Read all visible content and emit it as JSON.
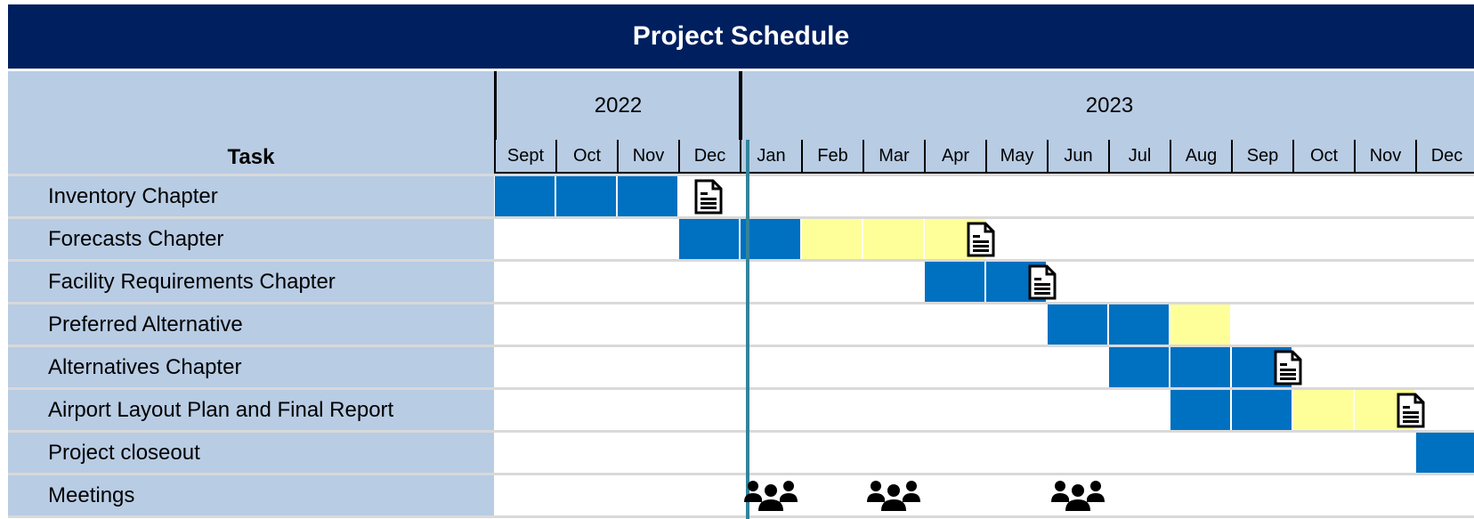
{
  "title": "Project Schedule",
  "header": {
    "task_label": "Task",
    "years": [
      {
        "label": "2022",
        "span": 4
      },
      {
        "label": "2023",
        "span": 12
      }
    ],
    "months": [
      "Sept",
      "Oct",
      "Nov",
      "Dec",
      "Jan",
      "Feb",
      "Mar",
      "Apr",
      "May",
      "Jun",
      "Jul",
      "Aug",
      "Sep",
      "Oct",
      "Nov",
      "Dec"
    ]
  },
  "colors": {
    "title_bg": "#001f5f",
    "header_bg": "#b8cce4",
    "active": "#0070c0",
    "review": "#ffff99",
    "today_line": "#31849b"
  },
  "current_month_marker": "Jan 2023",
  "tasks": [
    {
      "label": "Inventory Chapter",
      "active": [
        0,
        1,
        2
      ],
      "review": [],
      "deliverable": 3
    },
    {
      "label": "Forecasts Chapter",
      "active": [
        3,
        4
      ],
      "review": [
        5,
        6,
        7
      ],
      "deliverable": 7
    },
    {
      "label": "Facility Requirements Chapter",
      "active": [
        7,
        8
      ],
      "review": [],
      "deliverable": 8
    },
    {
      "label": "Preferred Alternative",
      "active": [
        9,
        10
      ],
      "review": [
        11
      ],
      "deliverable": null
    },
    {
      "label": "Alternatives Chapter",
      "active": [
        10,
        11,
        12
      ],
      "review": [],
      "deliverable": 12
    },
    {
      "label": "Airport Layout Plan and Final Report",
      "active": [
        11,
        12
      ],
      "review": [
        13,
        14
      ],
      "deliverable": 14
    },
    {
      "label": "Project closeout",
      "active": [
        15
      ],
      "review": [],
      "deliverable": null
    },
    {
      "label": "Meetings",
      "active": [],
      "review": [],
      "deliverable": null,
      "meetings": [
        4,
        6,
        9
      ]
    }
  ],
  "icons": {
    "deliverable": "document-icon",
    "meeting": "people-group-icon"
  }
}
